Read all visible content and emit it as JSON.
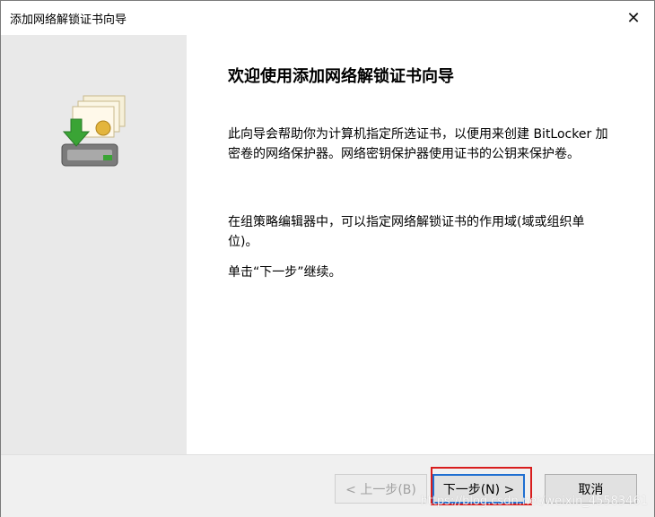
{
  "window": {
    "title": "添加网络解锁证书向导",
    "close_glyph": "✕"
  },
  "content": {
    "heading": "欢迎使用添加网络解锁证书向导",
    "p1": "此向导会帮助你为计算机指定所选证书，以便用来创建 BitLocker 加密卷的网络保护器。网络密钥保护器使用证书的公钥来保护卷。",
    "p2": "在组策略编辑器中，可以指定网络解锁证书的作用域(域或组织单位)。",
    "p3": "单击“下一步”继续。"
  },
  "buttons": {
    "back": "< 上一步(B)",
    "next": "下一步(N) >",
    "cancel": "取消"
  },
  "watermark": "https://blog.csdn.net/weixin_45583461",
  "icons": {
    "wizard": "certificate-computer-icon"
  }
}
